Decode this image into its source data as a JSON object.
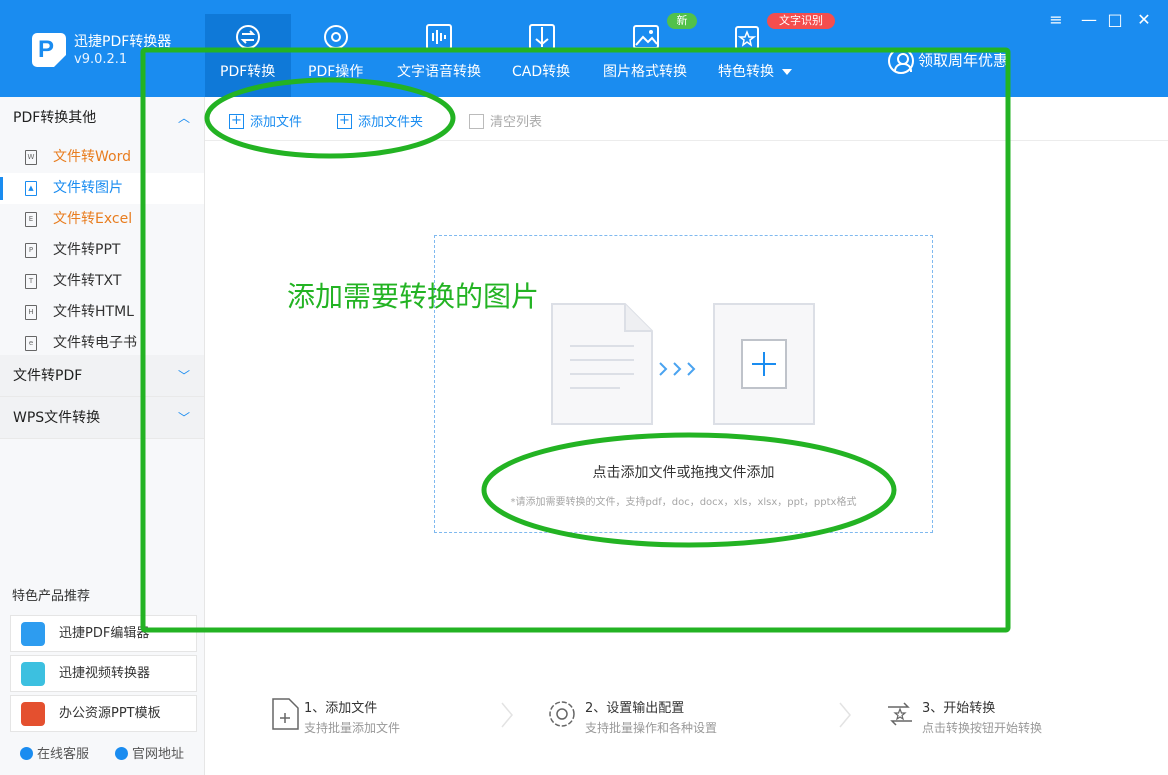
{
  "app": {
    "title": "迅捷PDF转换器",
    "version": "v9.0.2.1"
  },
  "nav": {
    "tabs": [
      {
        "label": "PDF转换",
        "icon": "convert-icon",
        "active": true
      },
      {
        "label": "PDF操作",
        "icon": "gear-icon"
      },
      {
        "label": "文字语音转换",
        "icon": "audio-wave-icon"
      },
      {
        "label": "CAD转换",
        "icon": "cad-icon"
      },
      {
        "label": "图片格式转换",
        "icon": "image-icon",
        "badge": "新"
      },
      {
        "label": "特色转换",
        "icon": "star-box-icon",
        "badge": "文字识别",
        "dropdown": true
      }
    ],
    "promo": "领取周年优惠"
  },
  "window_controls": {
    "menu": "≡",
    "minimize": "—",
    "maximize": "□",
    "close": "✕"
  },
  "sidebar": {
    "sections": [
      {
        "label": "PDF转换其他",
        "expanded": true,
        "items": [
          {
            "label": "文件转Word",
            "icon_letter": "W",
            "color": "#e87d1f"
          },
          {
            "label": "文件转图片",
            "icon_letter": "img",
            "active": true
          },
          {
            "label": "文件转Excel",
            "icon_letter": "E",
            "color": "#e87d1f"
          },
          {
            "label": "文件转PPT",
            "icon_letter": "P"
          },
          {
            "label": "文件转TXT",
            "icon_letter": "T"
          },
          {
            "label": "文件转HTML",
            "icon_letter": "H"
          },
          {
            "label": "文件转电子书",
            "icon_letter": "e"
          }
        ]
      },
      {
        "label": "文件转PDF",
        "expanded": false
      },
      {
        "label": "WPS文件转换",
        "expanded": false
      }
    ],
    "recommend_title": "特色产品推荐",
    "recommend": [
      {
        "label": "迅捷PDF编辑器"
      },
      {
        "label": "迅捷视频转换器"
      },
      {
        "label": "办公资源PPT模板"
      }
    ],
    "footer": {
      "service": "在线客服",
      "website": "官网地址"
    }
  },
  "toolbar": {
    "add_file": "添加文件",
    "add_folder": "添加文件夹",
    "clear_list": "清空列表"
  },
  "dropzone": {
    "main": "点击添加文件或拖拽文件添加",
    "sub": "*请添加需要转换的文件，支持pdf，doc，docx，xls，xlsx，ppt，pptx格式"
  },
  "annotation": {
    "text": "添加需要转换的图片",
    "color": "#23b323"
  },
  "steps": [
    {
      "title": "1、添加文件",
      "sub": "支持批量添加文件"
    },
    {
      "title": "2、设置输出配置",
      "sub": "支持批量操作和各种设置"
    },
    {
      "title": "3、开始转换",
      "sub": "点击转换按钮开始转换"
    }
  ],
  "colors": {
    "primary": "#1a8cf0",
    "accent_orange": "#e87d1f",
    "annotation_green": "#23b323"
  }
}
